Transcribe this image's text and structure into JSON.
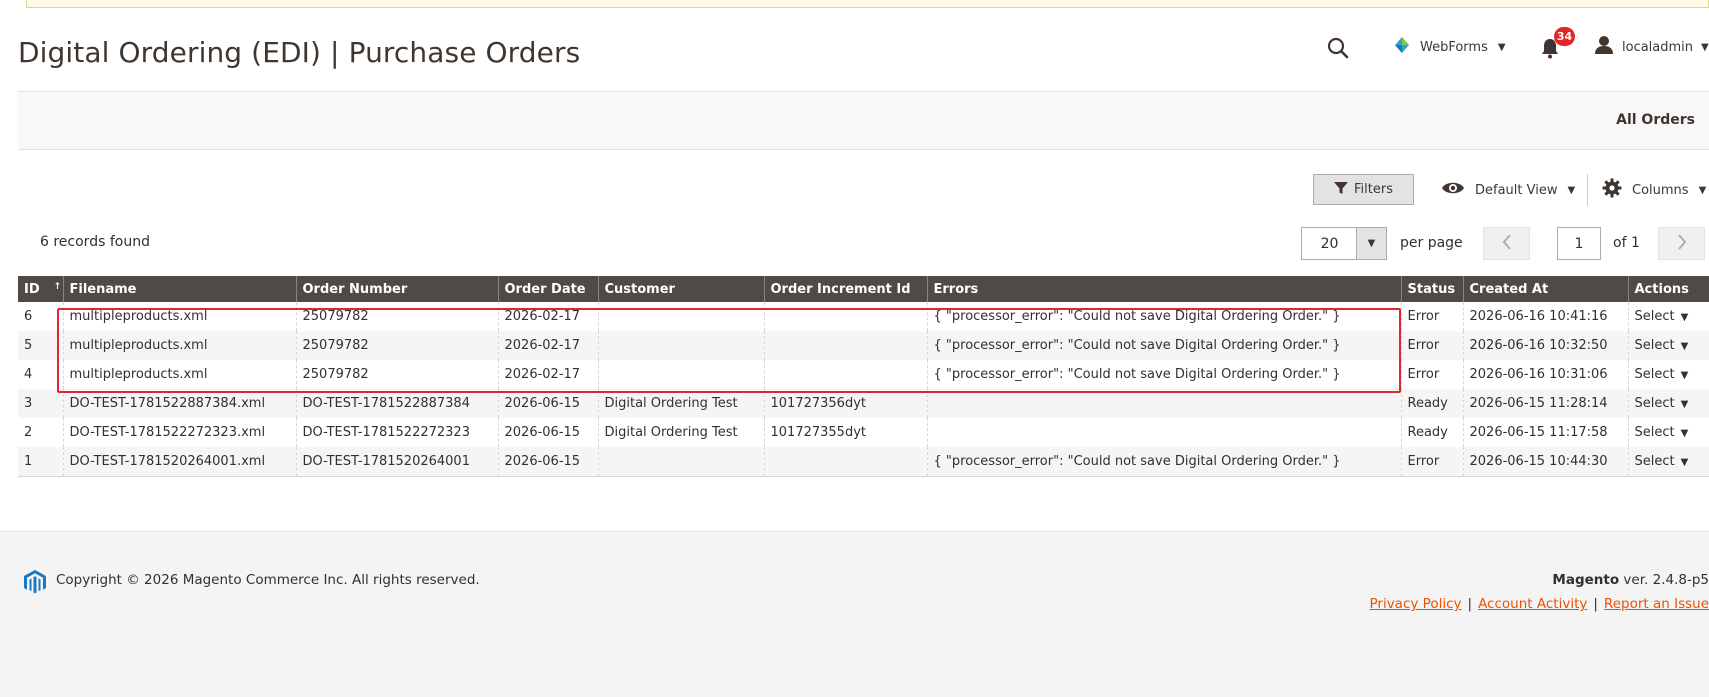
{
  "header": {
    "title": "Digital Ordering (EDI) | Purchase Orders",
    "webforms_label": "WebForms",
    "notification_count": "34",
    "user_label": "localadmin"
  },
  "switcher": {
    "all_orders_label": "All Orders"
  },
  "toolbar": {
    "filters_label": "Filters",
    "view_label": "Default View",
    "columns_label": "Columns"
  },
  "pager": {
    "records_found": "6 records found",
    "per_page_value": "20",
    "per_page_label": "per page",
    "current_page": "1",
    "total_pages_label": "of 1"
  },
  "grid": {
    "columns": [
      "ID",
      "Filename",
      "Order Number",
      "Order Date",
      "Customer",
      "Order Increment Id",
      "Errors",
      "Status",
      "Created At",
      "Actions"
    ],
    "rows": [
      {
        "id": "6",
        "filename": "multipleproducts.xml",
        "order_number": "25079782",
        "order_date": "2026-02-17",
        "customer": "",
        "increment_id": "",
        "errors": "{ \"processor_error\": \"Could not save Digital Ordering Order.\" }",
        "status": "Error",
        "created_at": "2026-06-16 10:41:16",
        "action": "Select"
      },
      {
        "id": "5",
        "filename": "multipleproducts.xml",
        "order_number": "25079782",
        "order_date": "2026-02-17",
        "customer": "",
        "increment_id": "",
        "errors": "{ \"processor_error\": \"Could not save Digital Ordering Order.\" }",
        "status": "Error",
        "created_at": "2026-06-16 10:32:50",
        "action": "Select"
      },
      {
        "id": "4",
        "filename": "multipleproducts.xml",
        "order_number": "25079782",
        "order_date": "2026-02-17",
        "customer": "",
        "increment_id": "",
        "errors": "{ \"processor_error\": \"Could not save Digital Ordering Order.\" }",
        "status": "Error",
        "created_at": "2026-06-16 10:31:06",
        "action": "Select"
      },
      {
        "id": "3",
        "filename": "DO-TEST-1781522887384.xml",
        "order_number": "DO-TEST-1781522887384",
        "order_date": "2026-06-15",
        "customer": "Digital Ordering Test",
        "increment_id": "101727356dyt",
        "errors": "",
        "status": "Ready",
        "created_at": "2026-06-15 11:28:14",
        "action": "Select"
      },
      {
        "id": "2",
        "filename": "DO-TEST-1781522272323.xml",
        "order_number": "DO-TEST-1781522272323",
        "order_date": "2026-06-15",
        "customer": "Digital Ordering Test",
        "increment_id": "101727355dyt",
        "errors": "",
        "status": "Ready",
        "created_at": "2026-06-15 11:17:58",
        "action": "Select"
      },
      {
        "id": "1",
        "filename": "DO-TEST-1781520264001.xml",
        "order_number": "DO-TEST-1781520264001",
        "order_date": "2026-06-15",
        "customer": "",
        "increment_id": "",
        "errors": "{ \"processor_error\": \"Could not save Digital Ordering Order.\" }",
        "status": "Error",
        "created_at": "2026-06-15 10:44:30",
        "action": "Select"
      }
    ]
  },
  "footer": {
    "copyright": "Copyright © 2026 Magento Commerce Inc. All rights reserved.",
    "brand": "Magento",
    "version": "ver. 2.4.8-p5",
    "links": [
      "Privacy Policy",
      "Account Activity",
      "Report an Issue"
    ]
  },
  "colors": {
    "header_bg": "#514943",
    "link": "#007bdb",
    "footer_link": "#eb5202",
    "highlight": "#e0272b",
    "badge": "#e22626"
  }
}
